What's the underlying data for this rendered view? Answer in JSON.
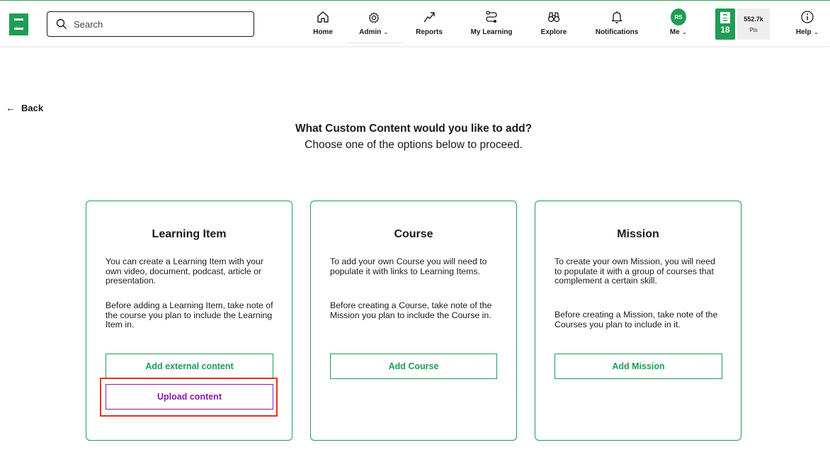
{
  "header": {
    "search_placeholder": "Search",
    "nav": {
      "home": "Home",
      "admin": "Admin",
      "reports": "Reports",
      "my_learning": "My Learning",
      "explore": "Explore",
      "notifications": "Notifications",
      "me": "Me",
      "help": "Help"
    },
    "avatar_initials": "RS",
    "level": "18",
    "points_value": "552.7k",
    "points_label": "Pts"
  },
  "page": {
    "back_label": "Back",
    "heading": "What Custom Content would you like to add?",
    "subheading": "Choose one of the options below to proceed."
  },
  "cards": [
    {
      "title": "Learning Item",
      "para1": "You can create a Learning Item with your own video, document, podcast, article or presentation.",
      "para2": "Before adding a Learning Item, take note of the course you plan to include the Learning Item in.",
      "button1": "Add external content",
      "button2": "Upload content"
    },
    {
      "title": "Course",
      "para1": "To add your own Course you will need to populate it with links to Learning Items.",
      "para2": "Before creating a Course, take note of the Mission you plan to include the Course in.",
      "button1": "Add Course"
    },
    {
      "title": "Mission",
      "para1": "To create your own Mission, you will need to populate it with a group of courses that complement a certain skill.",
      "para2": "Before creating a Mission, take note of the Courses you plan to include in it.",
      "button1": "Add Mission"
    }
  ],
  "colors": {
    "brand_green": "#1f9d55",
    "upload_purple": "#8a1aa8",
    "highlight_red": "#e0341c"
  }
}
